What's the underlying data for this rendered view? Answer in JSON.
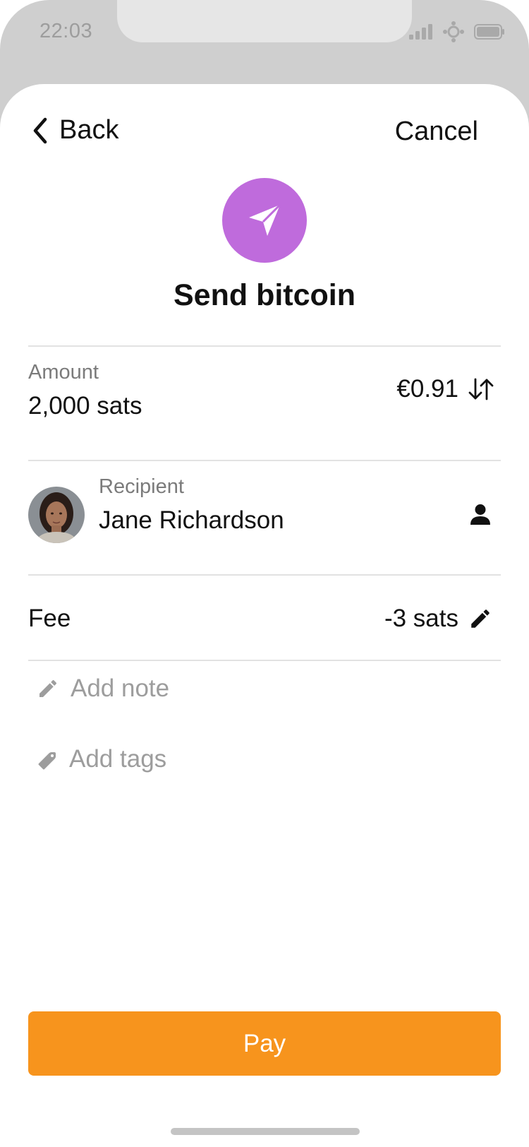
{
  "status_bar": {
    "time": "22:03"
  },
  "nav": {
    "back_label": "Back",
    "cancel_label": "Cancel"
  },
  "header": {
    "icon": "send-icon",
    "title": "Send bitcoin",
    "icon_color": "#bf6bdc"
  },
  "amount": {
    "label": "Amount",
    "value": "2,000 sats",
    "fiat_value": "€0.91",
    "swap_icon": "swap-icon"
  },
  "recipient": {
    "label": "Recipient",
    "name": "Jane Richardson",
    "contact_icon": "person-icon"
  },
  "fee": {
    "label": "Fee",
    "value": "-3 sats",
    "edit_icon": "pencil-icon"
  },
  "actions": {
    "add_note": "Add note",
    "add_tags": "Add tags"
  },
  "pay_button": {
    "label": "Pay",
    "color": "#f7941d"
  }
}
